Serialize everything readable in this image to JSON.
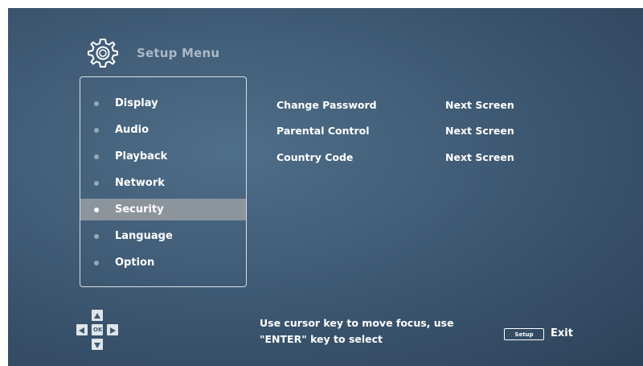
{
  "header": {
    "title": "Setup Menu",
    "icon": "gear-icon"
  },
  "sidebar": {
    "items": [
      {
        "label": "Display"
      },
      {
        "label": "Audio"
      },
      {
        "label": "Playback"
      },
      {
        "label": "Network"
      },
      {
        "label": "Security",
        "selected": true
      },
      {
        "label": "Language"
      },
      {
        "label": "Option"
      }
    ]
  },
  "options": [
    {
      "label": "Change Password",
      "value": "Next Screen"
    },
    {
      "label": "Parental Control",
      "value": "Next Screen"
    },
    {
      "label": "Country Code",
      "value": "Next Screen"
    }
  ],
  "footer": {
    "dpad_center": "OK",
    "help_line1": "Use cursor key to move focus, use",
    "help_line2": "\"ENTER\" key to select",
    "setup_key": "Setup",
    "exit_label": "Exit"
  },
  "colors": {
    "background": "#3f5a74",
    "selected_row": "#8c949c",
    "text": "#ffffff",
    "title_text": "#aab9c7"
  }
}
